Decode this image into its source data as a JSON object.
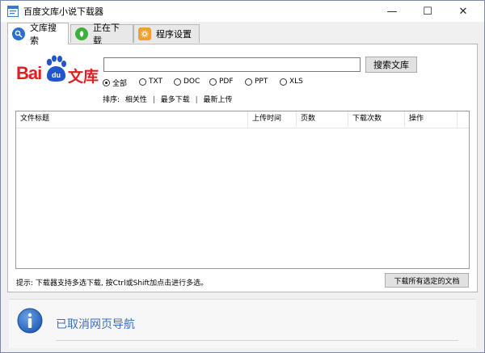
{
  "window": {
    "title": "百度文库小说下载器",
    "icon": "app-window-icon",
    "controls": {
      "minimize": "—",
      "maximize": "☐",
      "close": "✕"
    }
  },
  "tabs": [
    {
      "label": "文库搜索",
      "icon": "search-tab-icon",
      "color": "#2d6fd0",
      "active": true
    },
    {
      "label": "正在下载",
      "icon": "download-tab-icon",
      "color": "#3bb03a",
      "active": false
    },
    {
      "label": "程序设置",
      "icon": "settings-tab-icon",
      "color": "#f0a030",
      "active": false
    }
  ],
  "logo": {
    "bai": "Bai",
    "du": "du",
    "wenku": "文库",
    "color": "#de1e20",
    "paw_color": "#2255cc"
  },
  "search": {
    "value": "",
    "placeholder": "",
    "button_label": "搜索文库"
  },
  "formats": {
    "selected": "全部",
    "options": [
      "全部",
      "TXT",
      "DOC",
      "PDF",
      "PPT",
      "XLS"
    ]
  },
  "sort": {
    "label": "排序:",
    "options": [
      "相关性",
      "最多下载",
      "最新上传"
    ],
    "separator": "|"
  },
  "table": {
    "columns": [
      "文件标题",
      "上传时间",
      "页数",
      "下载次数",
      "操作"
    ],
    "rows": []
  },
  "footer": {
    "hint": "提示: 下载器支持多选下载, 按Ctrl或Shift加点击进行多选。",
    "download_all_label": "下载所有选定的文档"
  },
  "infobar": {
    "icon": "info-icon",
    "message": "已取消网页导航",
    "color": "#3e6fb4"
  }
}
